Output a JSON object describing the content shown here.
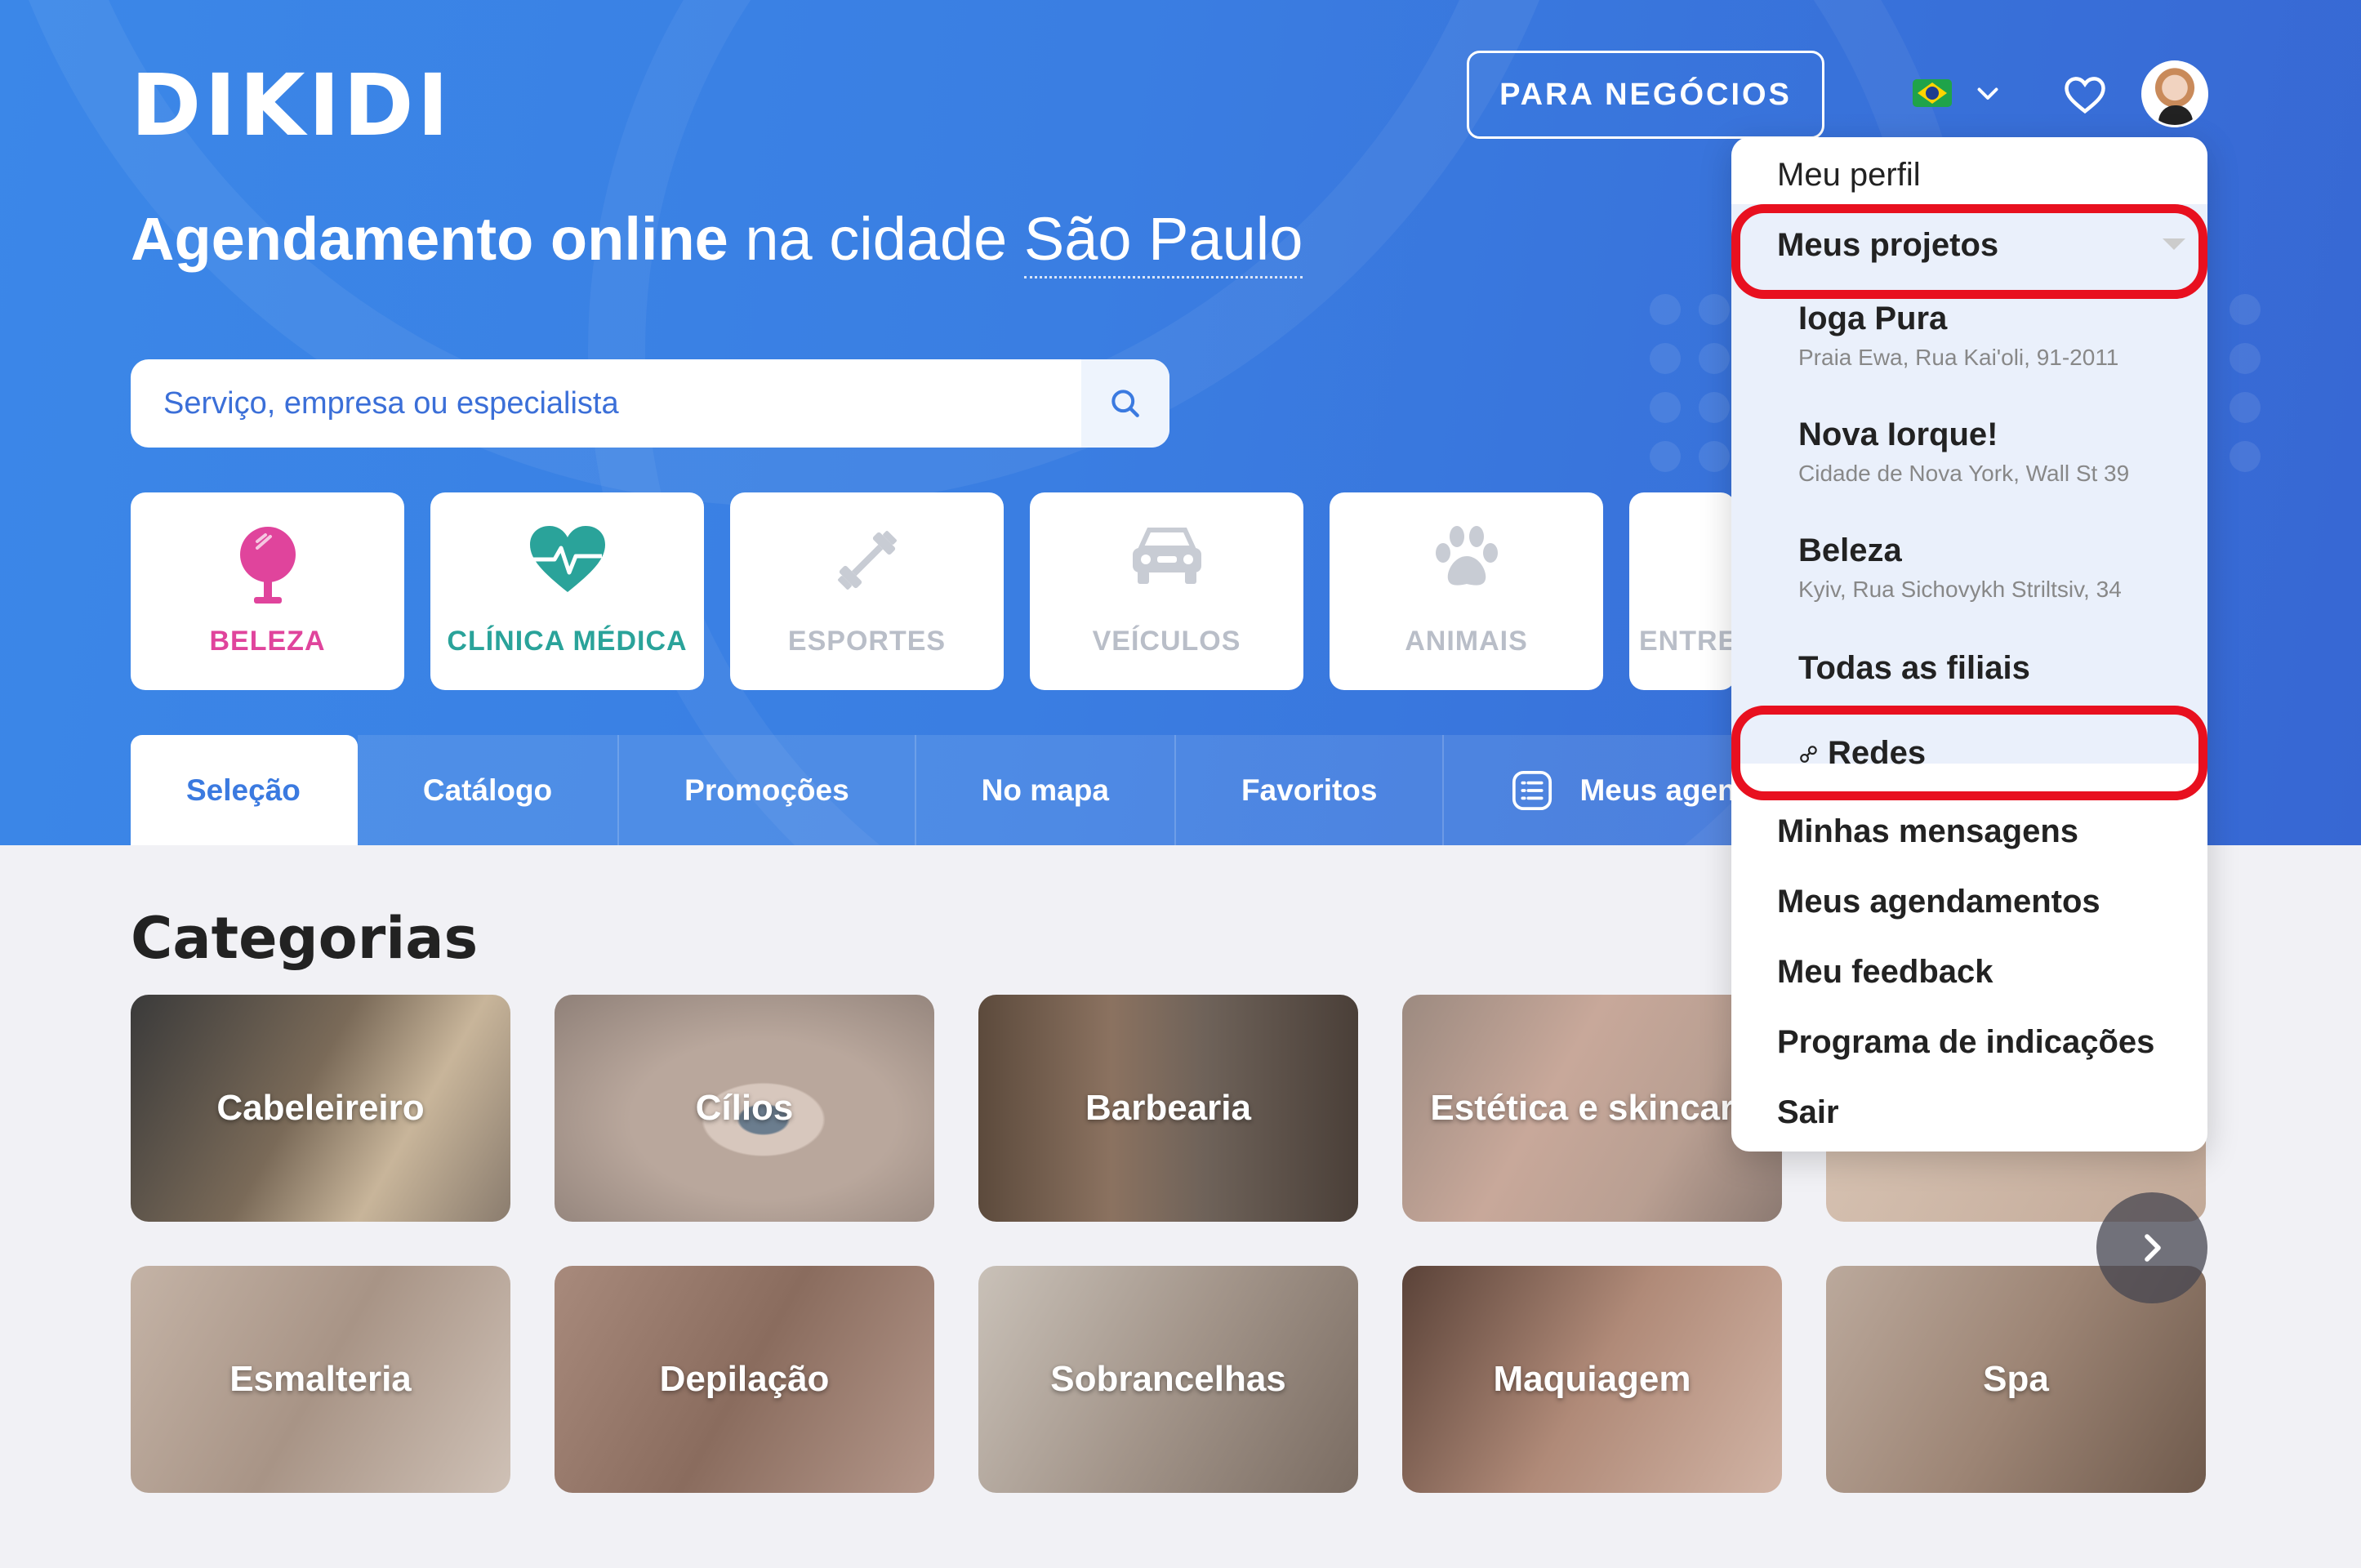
{
  "brand": {
    "logo": "DIKIDI"
  },
  "header": {
    "business_button": "PARA NEGÓCIOS"
  },
  "hero": {
    "headline_bold": "Agendamento online",
    "headline_rest": " na cidade ",
    "city": "São Paulo"
  },
  "search": {
    "placeholder": "Serviço, empresa ou especialista"
  },
  "categories_top": [
    {
      "label": "BELEZA",
      "color": "#e0449c"
    },
    {
      "label": "CLÍNICA MÉDICA",
      "color": "#2aa39a"
    },
    {
      "label": "ESPORTES",
      "color": "#b9bec8"
    },
    {
      "label": "VEÍCULOS",
      "color": "#b9bec8"
    },
    {
      "label": "ANIMAIS",
      "color": "#b9bec8"
    },
    {
      "label": "ENTRE",
      "color": "#b9bec8"
    }
  ],
  "tabs": [
    "Seleção",
    "Catálogo",
    "Promoções",
    "No mapa",
    "Favoritos",
    "Meus agenda"
  ],
  "section": {
    "title": "Categorias"
  },
  "tiles_row1": [
    "Cabeleireiro",
    "Cílios",
    "Barbearia",
    "Estética e skincare"
  ],
  "tiles_row2": [
    "Esmalteria",
    "Depilação",
    "Sobrancelhas",
    "Maquiagem",
    "Spa"
  ],
  "menu": {
    "profile": "Meu perfil",
    "projects": "Meus projetos",
    "project_list": [
      {
        "name": "Ioga Pura",
        "address": "Praia Ewa, Rua Kai'oli, 91-2011"
      },
      {
        "name": "Nova Iorque!",
        "address": "Cidade de Nova York, Wall St 39"
      },
      {
        "name": "Beleza",
        "address": "Kyiv, Rua Sichovykh Striltsiv, 34"
      }
    ],
    "all_branches": "Todas as filiais",
    "networks": "Redes",
    "messages": "Minhas mensagens",
    "appointments": "Meus agendamentos",
    "feedback": "Meu feedback",
    "referral": "Programa de indicações",
    "logout": "Sair"
  },
  "colors": {
    "accent": "#3b7ae0",
    "highlight": "#e8101f"
  }
}
